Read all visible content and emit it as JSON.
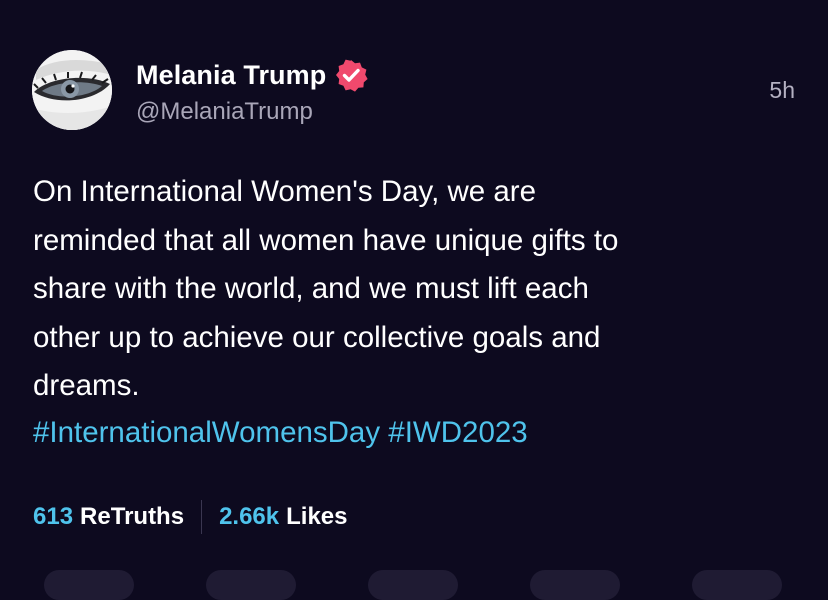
{
  "author": {
    "display_name": "Melania Trump",
    "handle": "@MelaniaTrump",
    "verified_icon": "verified-badge-icon",
    "avatar_icon": "avatar-photo-eye"
  },
  "post": {
    "timestamp": "5h",
    "text": "On International Women's Day, we are\nreminded that all women have unique gifts to\nshare with the world, and we must lift each\nother up to achieve our collective goals and\ndreams.",
    "hashtags": [
      "#InternationalWomensDay",
      "#IWD2023"
    ]
  },
  "stats": {
    "retruths_count": "613",
    "retruths_label": "ReTruths",
    "likes_count": "2.66k",
    "likes_label": "Likes"
  },
  "colors": {
    "background": "#0d0a1f",
    "link": "#4fc3ec",
    "verified": "#f0496d",
    "muted": "#a9a6b8"
  }
}
